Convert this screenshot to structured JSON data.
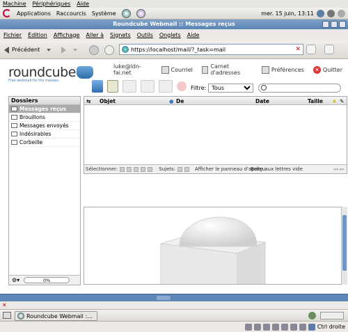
{
  "vm_menu": [
    "Machine",
    "Périphériques",
    "Aide"
  ],
  "gnome_panel": {
    "menus": [
      "Applications",
      "Raccourcis",
      "Système"
    ],
    "datetime": "mer. 15 juin, 13:11",
    "icons": [
      "debian-logo-icon",
      "help-icon",
      "mail-icon",
      "network-icon",
      "volume-icon",
      "power-icon"
    ]
  },
  "window": {
    "title": "Roundcube Webmail :: Messages reçus"
  },
  "firefox_menu": [
    {
      "label": "Fichier"
    },
    {
      "label": "Édition"
    },
    {
      "label": "Affichage"
    },
    {
      "label": "Aller à"
    },
    {
      "label": "Signets"
    },
    {
      "label": "Outils"
    },
    {
      "label": "Onglets"
    },
    {
      "label": "Aide"
    }
  ],
  "navbar": {
    "back_label": "Précédent",
    "url": "https://localhost/mail/?_task=mail"
  },
  "roundcube": {
    "logo_text": "roundcube",
    "logo_tagline": "Free webmail for the masses",
    "user": "luke@ldn-fai.net",
    "top_links": [
      "Courriel",
      "Carnet d'adresses",
      "Préférences",
      "Quitter"
    ],
    "filter_label": "Filtre:",
    "filter_value": "Tous",
    "search_placeholder": ""
  },
  "folders": {
    "header": "Dossiers",
    "items": [
      "Messages reçus",
      "Brouillons",
      "Messages envoyés",
      "Indésirables",
      "Corbeille"
    ],
    "selected_index": 0,
    "quota_text": "0%"
  },
  "message_list": {
    "columns": [
      "Objet",
      "De",
      "Date",
      "Taille"
    ],
    "footer": {
      "select_label": "Sélectionner:",
      "threads_label": "Sujets:",
      "preview_toggle": "Afficher le panneau d'aperçu",
      "status": "Boîte aux lettres vide"
    }
  },
  "taskbar": {
    "window_button": "Roundcube Webmail :..."
  },
  "vm_status": {
    "host_key": "Ctrl droite"
  },
  "colors": {
    "title_bar": "#5b84b3",
    "selection": "#aaaaaa",
    "accent": "#3a7bb8",
    "scroll_blue": "#5d86b8"
  }
}
